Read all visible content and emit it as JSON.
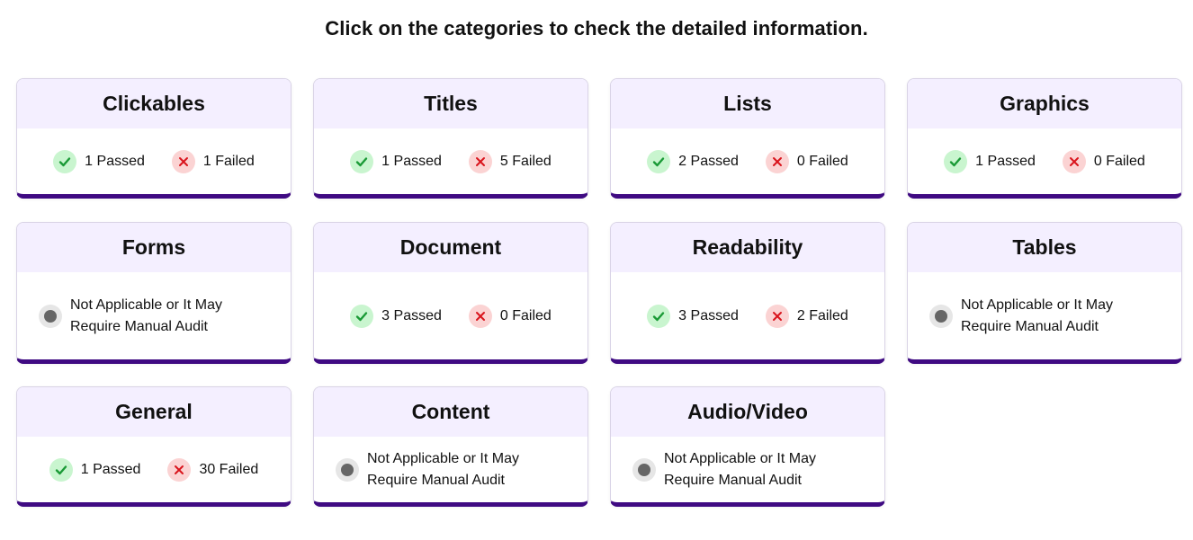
{
  "heading": "Click on the categories to check the detailed information.",
  "colors": {
    "accent": "#3f0a82",
    "header_bg": "#f4efff",
    "pass": "#1a9a36",
    "fail": "#d9141c",
    "na": "#666666"
  },
  "cards": [
    {
      "title": "Clickables",
      "type": "stats",
      "passed": "1 Passed",
      "failed": "1 Failed"
    },
    {
      "title": "Titles",
      "type": "stats",
      "passed": "1 Passed",
      "failed": "5 Failed"
    },
    {
      "title": "Lists",
      "type": "stats",
      "passed": "2 Passed",
      "failed": "0 Failed"
    },
    {
      "title": "Graphics",
      "type": "stats",
      "passed": "1 Passed",
      "failed": "0 Failed"
    },
    {
      "title": "Forms",
      "type": "na",
      "note": "Not Applicable or It May Require Manual Audit"
    },
    {
      "title": "Document",
      "type": "stats",
      "passed": "3 Passed",
      "failed": "0 Failed"
    },
    {
      "title": "Readability",
      "type": "stats",
      "passed": "3 Passed",
      "failed": "2 Failed"
    },
    {
      "title": "Tables",
      "type": "na",
      "note": "Not Applicable or It May Require Manual Audit"
    },
    {
      "title": "General",
      "type": "stats",
      "passed": "1 Passed",
      "failed": "30 Failed"
    },
    {
      "title": "Content",
      "type": "na",
      "note": "Not Applicable or It May Require Manual Audit"
    },
    {
      "title": "Audio/Video",
      "type": "na",
      "note": "Not Applicable or It May Require Manual Audit"
    }
  ]
}
